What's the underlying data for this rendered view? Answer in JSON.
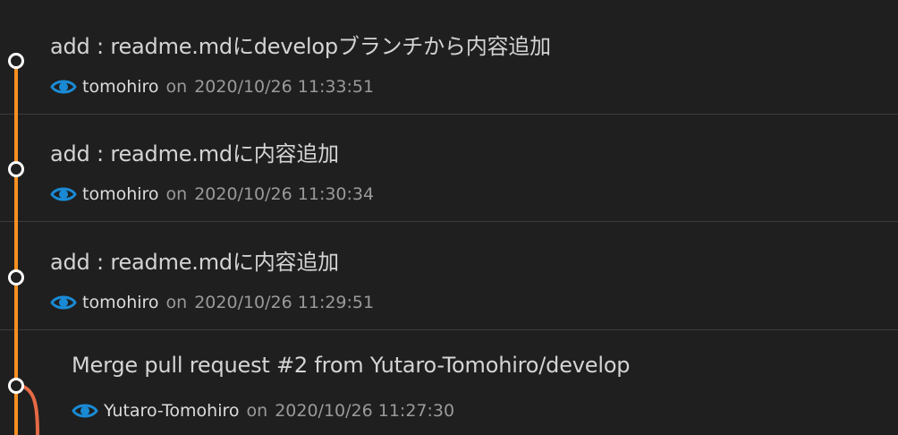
{
  "commits": [
    {
      "message": "add : readme.mdにdevelopブランチから内容追加",
      "author": "tomohiro",
      "on": "on",
      "timestamp": "2020/10/26 11:33:51",
      "icon": "eye-icon"
    },
    {
      "message": "add : readme.mdに内容追加",
      "author": "tomohiro",
      "on": "on",
      "timestamp": "2020/10/26 11:30:34",
      "icon": "eye-icon"
    },
    {
      "message": "add : readme.mdに内容追加",
      "author": "tomohiro",
      "on": "on",
      "timestamp": "2020/10/26 11:29:51",
      "icon": "eye-icon"
    },
    {
      "message": "Merge pull request #2 from Yutaro-Tomohiro/develop",
      "author": "Yutaro-Tomohiro",
      "on": "on",
      "timestamp": "2020/10/26 11:27:30",
      "icon": "eye-icon"
    }
  ],
  "colors": {
    "main_branch": "#f59020",
    "merged_branch": "#e56a45",
    "icon": "#1a8ad4",
    "background": "#1f1f1f",
    "divider": "#3c3c3c"
  }
}
